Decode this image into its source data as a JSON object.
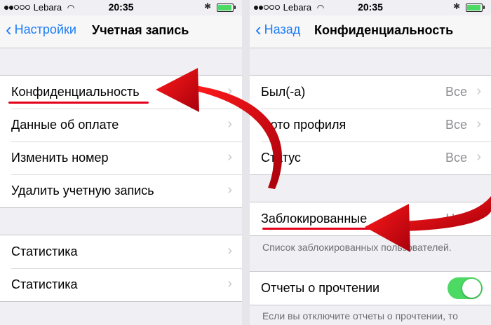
{
  "left": {
    "status": {
      "carrier": "Lebara",
      "time": "20:35"
    },
    "nav": {
      "back_label": "Настройки",
      "title": "Учетная запись"
    },
    "group1": [
      {
        "label": "Конфиденциальность"
      },
      {
        "label": "Данные об оплате"
      },
      {
        "label": "Изменить номер"
      },
      {
        "label": "Удалить учетную запись"
      }
    ],
    "group2": [
      {
        "label": "Статистика"
      },
      {
        "label": "Статистика"
      }
    ]
  },
  "right": {
    "status": {
      "carrier": "Lebara",
      "time": "20:35"
    },
    "nav": {
      "back_label": "Назад",
      "title": "Конфиденциальность"
    },
    "group1": [
      {
        "label": "Был(-а)",
        "value": "Все"
      },
      {
        "label": "Фото профиля",
        "value": "Все"
      },
      {
        "label": "Статус",
        "value": "Все"
      }
    ],
    "blocked": {
      "label": "Заблокированные",
      "value": "Нет"
    },
    "blocked_note": "Список заблокированных пользователей.",
    "read_receipts": {
      "label": "Отчеты о прочтении",
      "enabled": true
    },
    "read_receipts_note": "Если вы отключите отчеты о прочтении, то"
  },
  "colors": {
    "accent": "#1b7cf6",
    "toggle_on": "#4cd964",
    "annotation": "#e3001b"
  }
}
